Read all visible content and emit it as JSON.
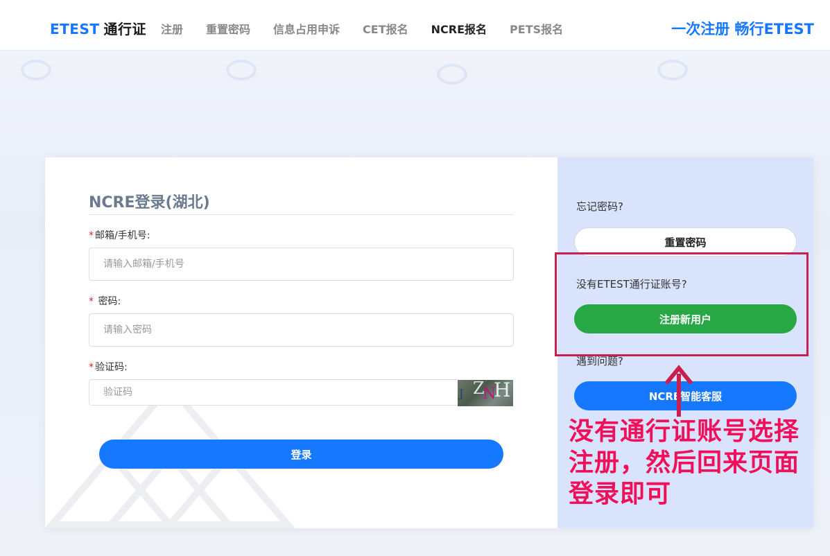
{
  "header": {
    "brand_en": "ETEST",
    "brand_cn": "通行证",
    "nav": [
      {
        "label": "注册",
        "active": false
      },
      {
        "label": "重置密码",
        "active": false
      },
      {
        "label": "信息占用申诉",
        "active": false
      },
      {
        "label": "CET报名",
        "active": false
      },
      {
        "label": "NCRE报名",
        "active": true
      },
      {
        "label": "PETS报名",
        "active": false
      }
    ],
    "slogan": "一次注册 畅行ETEST"
  },
  "login": {
    "title": "NCRE登录(湖北)",
    "email_label": "邮箱/手机号:",
    "email_placeholder": "请输入邮箱/手机号",
    "password_label": " 密码:",
    "password_placeholder": "请输入密码",
    "captcha_label": "验证码:",
    "captcha_placeholder": "验证码",
    "captcha_text": "JZNH",
    "required_mark": "*",
    "submit_label": "登录"
  },
  "sidebar": {
    "forgot_text": "忘记密码?",
    "reset_label": "重置密码",
    "no_account_text": "没有ETEST通行证账号?",
    "register_label": "注册新用户",
    "problem_text": "遇到问题?",
    "service_label": "NCRE智能客服"
  },
  "annotation": {
    "lines": [
      "没有通行证账号选择",
      "注册，然后回来页面",
      "登录即可"
    ]
  },
  "colors": {
    "accent": "#1677ff",
    "register_green": "#28a745",
    "annotation_red": "#f0105a",
    "right_pane": "#d9e3fb"
  }
}
